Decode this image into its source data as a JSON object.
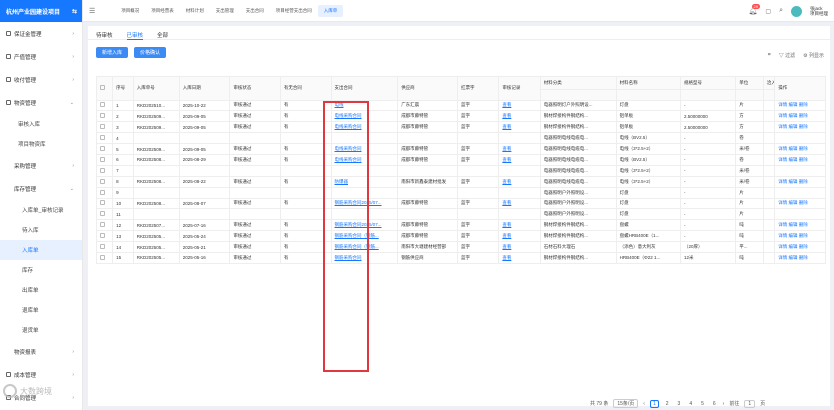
{
  "sidebar": {
    "title": "杭州产业园建设项目",
    "items": [
      {
        "label": "保证金管理"
      },
      {
        "label": "产值管理"
      },
      {
        "label": "收付管理"
      },
      {
        "label": "物资管理"
      }
    ],
    "sub_material": [
      "审核入库",
      " 项目物资库"
    ],
    "purchase": "采购管理",
    "warehouse": "库存管理",
    "warehouse_sub": [
      "入库单_审核记录",
      "待入库",
      "入库单",
      "库存",
      "出库单",
      "退库单",
      "退货单"
    ],
    "more": [
      "物资报表",
      "成本管理"
    ],
    "last": "合同管理"
  },
  "topbar": {
    "tabs": [
      "项目概况",
      "项目经营表",
      "材料计划",
      "支出管理",
      "支出合同",
      "项目经营支出合同",
      "入库单"
    ],
    "notif_count": "29",
    "user_name": "张jack",
    "user_role": "项目经理"
  },
  "subtabs": [
    "待审核",
    "已审核",
    "全部"
  ],
  "buttons": {
    "in": "新增入库",
    "confirm": "价格确认"
  },
  "tools": {
    "filter": "过滤",
    "cols": "列显示"
  },
  "headers": [
    "序号",
    "入库单号",
    "入库日期",
    "审核状态",
    "有无合同",
    "支出合同",
    "供应商",
    "扛票字",
    "审核记录",
    "材料分类",
    "材料名称",
    "规格型号",
    "单位",
    "洽入",
    "操作"
  ],
  "rows": [
    [
      "1",
      "RKD202510...",
      "2025-10-22",
      "审核通过",
      "有",
      "电线",
      "广东汇晨",
      "蓝字",
      "查看",
      "电器照明灯户外照明设...",
      "灯盘",
      "-",
      "片",
      "",
      "详情 编辑 删除"
    ],
    [
      "2",
      "RKD202509...",
      "2025-09-05",
      "审核通过",
      "有",
      "电线采购合同",
      "成都市藤特管",
      "蓝字",
      "查看",
      "钢材焊接构件钢结构...",
      "铝单板",
      "2.50000000",
      "方",
      "",
      "详情 编辑 删除"
    ],
    [
      "3",
      "RKD202509...",
      "2025-09-05",
      "审核通过",
      "有",
      "电线采购合同",
      "成都市藤特管",
      "蓝字",
      "查看",
      "钢材焊接构件钢结构...",
      "铝单板",
      "2.50000000",
      "方",
      "",
      "详情 编辑 删除"
    ],
    [
      "4",
      "",
      "",
      "",
      "",
      "",
      "",
      "",
      "",
      "电器照明电线电缆电...",
      "电线（BV2.5）",
      "-",
      "卷",
      "",
      ""
    ],
    [
      "5",
      "RKD202509...",
      "2025-09-05",
      "审核通过",
      "有",
      "电线采购合同",
      "成都市藤特管",
      "蓝字",
      "查看",
      "电器照明电线电缆电...",
      "电线（3*2.5+2）",
      "-",
      "米/卷",
      "",
      "详情 编辑 删除"
    ],
    [
      "6",
      "RKD202508...",
      "2025-08-29",
      "审核通过",
      "有",
      "电线采购合同",
      "成都市藤特管",
      "蓝字",
      "查看",
      "电器照明电线电缆电...",
      "电线（BV2.5）",
      "-",
      "卷",
      "",
      "详情 编辑 删除"
    ],
    [
      "7",
      "",
      "",
      "",
      "",
      "",
      "",
      "",
      "",
      "电器照明电线电缆电...",
      "电线（3*2.5+2）",
      "-",
      "米/卷",
      "",
      ""
    ],
    [
      "8",
      "RKD202508...",
      "2025-08-22",
      "审核通过",
      "有",
      "防爆器",
      "南阳市新鑫泰建材批发",
      "蓝字",
      "查看",
      "电器照明电线电缆电...",
      "电线（3*2.5+2）",
      "-",
      "米/卷",
      "",
      "详情 编辑 删除"
    ],
    [
      "9",
      "",
      "",
      "",
      "",
      "",
      "",
      "",
      "",
      "电器照明户外照明设...",
      "灯盘",
      "-",
      "片",
      "",
      ""
    ],
    [
      "10",
      "RKD202508...",
      "2025-08-07",
      "审核通过",
      "有",
      "钢筋采购合同2025/07...",
      "成都市藤特管",
      "蓝字",
      "查看",
      "电器照明户外照明设...",
      "灯盘",
      "-",
      "片",
      "",
      "详情 编辑 删除"
    ],
    [
      "11",
      "",
      "",
      "",
      "",
      "",
      "",
      "",
      "",
      "电器照明户外照明设...",
      "灯盘",
      "-",
      "片",
      "",
      ""
    ],
    [
      "12",
      "RKD202507...",
      "2025-07-16",
      "审核通过",
      "有",
      "钢筋采购合同2025/07...",
      "成都市藤特管",
      "蓝字",
      "查看",
      "钢材焊接构件钢结构...",
      "盘螺",
      "-",
      "吨",
      "",
      "详情 编辑 删除"
    ],
    [
      "13",
      "RKD202505...",
      "2025-05-24",
      "审核通过",
      "有",
      "钢筋采购合同（钢筋...",
      "成都市藤特管",
      "蓝字",
      "查看",
      "钢材焊接构件钢结构...",
      "盘螺HRB400E（1...",
      "-",
      "吨",
      "",
      "详情 编辑 删除"
    ],
    [
      "14",
      "RKD202505...",
      "2025-05-21",
      "审核通过",
      "有",
      "钢筋采购合同（钢筋...",
      "南阳市大塘建材经营部",
      "蓝字",
      "查看",
      "石材石料大理石",
      "（添色）意大利灰",
      "（20厚）",
      "平...",
      "",
      "详情 编辑 删除"
    ],
    [
      "15",
      "RKD202505...",
      "2025-05-16",
      "审核通过",
      "有",
      "钢筋采购合同",
      "钢筋供应商",
      "蓝字",
      "查看",
      "钢材焊接构件钢结构...",
      "HRB400E（Φ22 1...",
      "12米",
      "吨",
      "",
      "详情 编辑 删除"
    ]
  ],
  "pager": {
    "total": "共 79 条",
    "size": "15条/页",
    "pages": [
      "1",
      "2",
      "3",
      "4",
      "5",
      "6"
    ],
    "current": "1",
    "goto_label": "前往",
    "goto_val": "1",
    "goto_unit": "页"
  },
  "watermark": "大数跨境"
}
